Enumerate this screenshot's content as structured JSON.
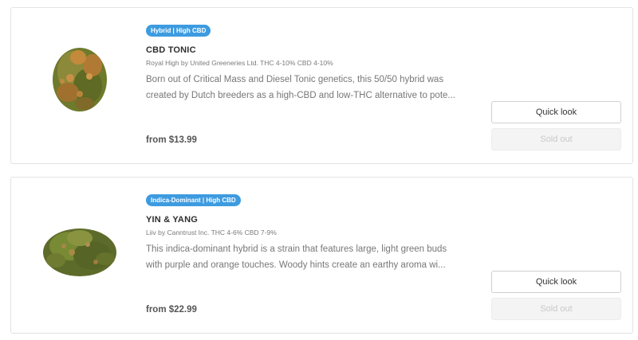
{
  "products": [
    {
      "badge": "Hybrid | High CBD",
      "name": "CBD TONIC",
      "meta": "Royal High by United Greeneries Ltd.  THC 4-10% CBD 4-10%",
      "description": "Born out of Critical Mass and Diesel Tonic genetics, this 50/50 hybrid was created  by Dutch breeders as a high-CBD and low-THC alternative to pote...",
      "price": "from $13.99",
      "quick_look_label": "Quick look",
      "sold_out_label": "Sold out"
    },
    {
      "badge": "Indica-Dominant | High CBD",
      "name": "YIN & YANG",
      "meta": "Liiv by Canntrust Inc.  THC 4-6% CBD 7-9%",
      "description": "This indica-dominant hybrid is a strain that features large, light green buds with purple and orange touches. Woody hints create an earthy aroma wi...",
      "price": "from $22.99",
      "quick_look_label": "Quick look",
      "sold_out_label": "Sold out"
    }
  ],
  "colors": {
    "badge": "#3d9be0",
    "card_border": "#e3e3e3",
    "sold_out_bg": "#f4f4f4"
  }
}
